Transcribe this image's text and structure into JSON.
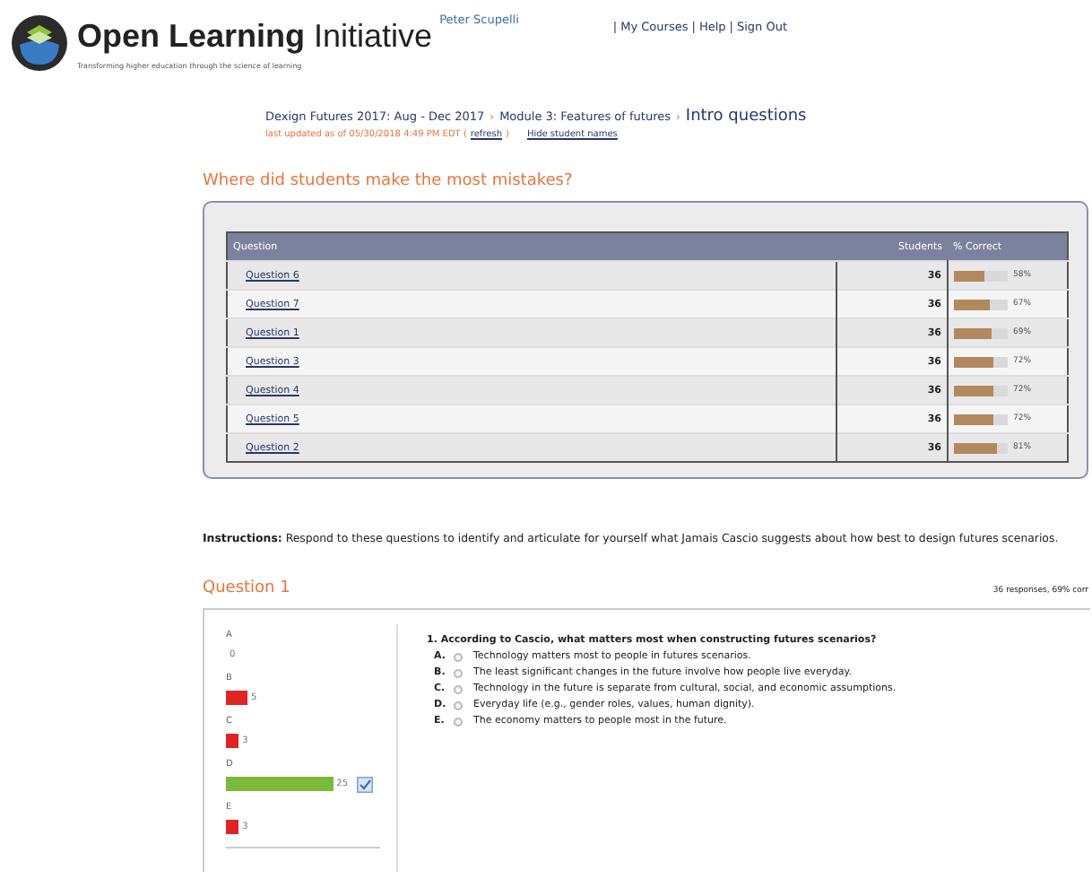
{
  "header": {
    "brand_bold": "Open Learning",
    "brand_light": "Initiative",
    "tagline": "Transforming higher education through the science of learning",
    "user": "Peter Scupelli",
    "link_separator": "|",
    "links": [
      "My Courses",
      "Help",
      "Sign Out"
    ]
  },
  "breadcrumb": {
    "items": [
      "Dexign Futures 2017: Aug - Dec 2017",
      "Module 3: Features of futures"
    ],
    "separator": "›",
    "current": "Intro questions",
    "updated": "last updated as of 05/30/2018 4:49 PM EDT (",
    "refresh": "refresh",
    "updated_end": ")",
    "hide_names": "Hide student names"
  },
  "mistakes": {
    "heading": "Where did students make the most mistakes?",
    "columns": [
      "Question",
      "Students",
      "% Correct"
    ],
    "rows": [
      {
        "question": "Question 6",
        "students": "36",
        "level": 0.58,
        "reading": "58%"
      },
      {
        "question": "Question 7",
        "students": "36",
        "level": 0.67,
        "reading": "67%"
      },
      {
        "question": "Question 1",
        "students": "36",
        "level": 0.69,
        "reading": "69%"
      },
      {
        "question": "Question 3",
        "students": "36",
        "level": 0.72,
        "reading": "72%"
      },
      {
        "question": "Question 4",
        "students": "36",
        "level": 0.72,
        "reading": "72%"
      },
      {
        "question": "Question 5",
        "students": "36",
        "level": 0.72,
        "reading": "72%"
      },
      {
        "question": "Question 2",
        "students": "36",
        "level": 0.81,
        "reading": "81%"
      }
    ]
  },
  "instructions": "**Instructions:** Respond to these questions to identify and articulate for yourself what Jamais Cascio suggests about how best to design futures scenarios.",
  "question": {
    "title": "Question 1",
    "summary": "36 responses, 69% corr",
    "answers": [
      {
        "label": "A",
        "count": "0",
        "level": 0,
        "correct": false
      },
      {
        "label": "B",
        "count": "5",
        "level": 0.139,
        "correct": false
      },
      {
        "label": "C",
        "count": "3",
        "level": 0.083,
        "correct": false
      },
      {
        "label": "D",
        "count": "25",
        "level": 0.694,
        "correct": true
      },
      {
        "label": "E",
        "count": "3",
        "level": 0.083,
        "correct": false
      }
    ],
    "prompt": "1. According to Cascio, what matters most when constructing futures scenarios?",
    "options": [
      {
        "letter": "A.",
        "text": "Technology matters most to people in futures scenarios.",
        "selected": false
      },
      {
        "letter": "B.",
        "text": "The least significant changes in the future involve how people live everyday.",
        "selected": false
      },
      {
        "letter": "C.",
        "text": "Technology in the future is separate from cultural, social, and economic assumptions.",
        "selected": false
      },
      {
        "letter": "D.",
        "text": "Everyday life (e.g., gender roles, values, human dignity).",
        "selected": false
      },
      {
        "letter": "E.",
        "text": "The economy matters to people most in the future.",
        "selected": false
      }
    ]
  }
}
